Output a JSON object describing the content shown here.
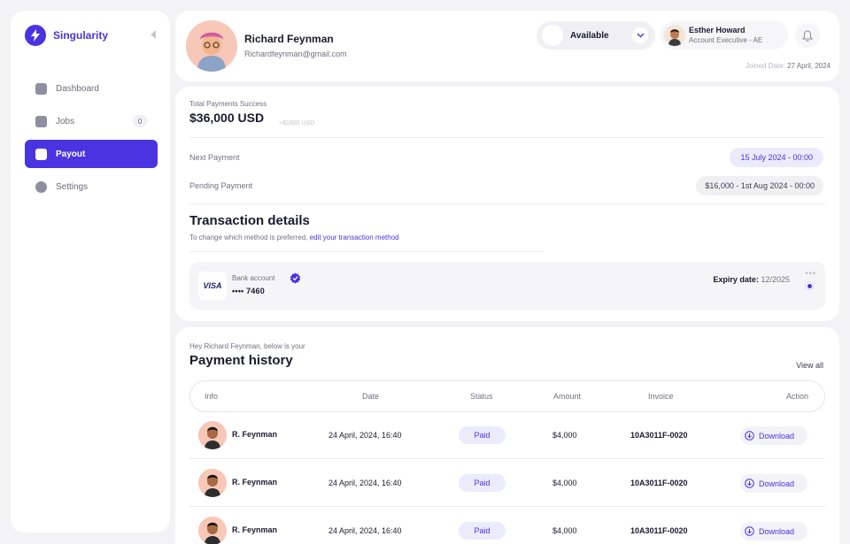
{
  "brand": {
    "name": "Singularity"
  },
  "sidebar": {
    "items": [
      {
        "label": "Dashboard"
      },
      {
        "label": "Jobs",
        "badge": "0"
      },
      {
        "label": "Payout"
      },
      {
        "label": "Settings"
      }
    ]
  },
  "header": {
    "user_name": "Richard Feynman",
    "user_email": "Richardfeynman@gmail.com",
    "availability": "Available",
    "manager_name": "Esther Howard",
    "manager_role": "Account Executive - AE",
    "joined_label": "Joined Date:",
    "joined_date": "27 April, 2024"
  },
  "payout": {
    "total_label": "Total Payments Success",
    "total_amount": "$36,000 USD",
    "total_delta": "+$1600 USD",
    "next_label": "Next Payment",
    "next_value": "15 July 2024 - 00:00",
    "pending_label": "Pending Payment",
    "pending_value": "$16,000 - 1st Aug 2024 - 00:00",
    "transaction_title": "Transaction details",
    "transaction_sub": "To change which method is preferred,",
    "transaction_link": "edit your transaction method",
    "card_brand": "VISA",
    "bank_label": "Bank account",
    "bank_number": "•••• 7460",
    "expiry_label": "Expiry date:",
    "expiry_value": "12/2025",
    "more_icon": "•••"
  },
  "history": {
    "greeting": "Hey Richard Feynman, below is your",
    "title": "Payment history",
    "view_all": "View all",
    "columns": [
      "Info",
      "Date",
      "Status",
      "Amount",
      "Invoice",
      "Action"
    ],
    "rows": [
      {
        "name": "R. Feynman",
        "date": "24 April, 2024, 16:40",
        "status": "Paid",
        "amount": "$4,000",
        "invoice": "10A3011F-0020",
        "action": "Download"
      },
      {
        "name": "R. Feynman",
        "date": "24 April, 2024, 16:40",
        "status": "Paid",
        "amount": "$4,000",
        "invoice": "10A3011F-0020",
        "action": "Download"
      },
      {
        "name": "R. Feynman",
        "date": "24 April, 2024, 16:40",
        "status": "Paid",
        "amount": "$4,000",
        "invoice": "10A3011F-0020",
        "action": "Download"
      }
    ]
  },
  "colors": {
    "accent": "#4a33e0",
    "background": "#f3f3f6",
    "pill_bg": "#ecebfb"
  },
  "icons": [
    "bolt-icon",
    "collapse-icon",
    "home-icon",
    "briefcase-icon",
    "wallet-icon",
    "gear-icon",
    "chevron-down-icon",
    "bell-icon",
    "verified-check-icon",
    "more-dots-icon",
    "download-icon"
  ]
}
